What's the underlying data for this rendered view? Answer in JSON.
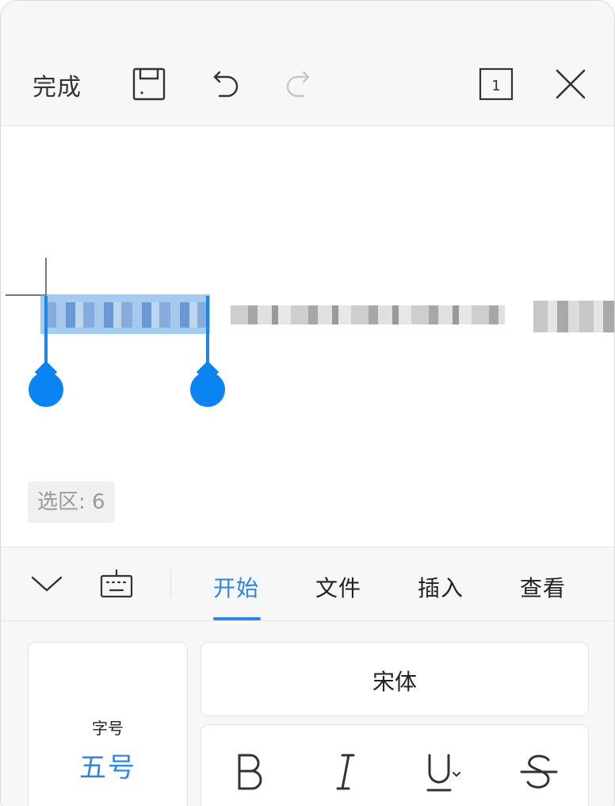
{
  "toolbar": {
    "done_label": "完成",
    "page_number": "1",
    "icons": [
      "save-icon",
      "undo-icon",
      "redo-icon",
      "page-count-icon",
      "close-icon"
    ]
  },
  "document": {
    "selection_count_label": "选区: 6"
  },
  "tabs": {
    "items": [
      {
        "label": "开始",
        "active": true
      },
      {
        "label": "文件",
        "active": false
      },
      {
        "label": "插入",
        "active": false
      },
      {
        "label": "查看",
        "active": false
      }
    ],
    "icons": [
      "chevron-down-icon",
      "keyboard-icon"
    ]
  },
  "format": {
    "font_size_label": "字号",
    "font_size_value": "五号",
    "font_family_value": "宋体",
    "styles": [
      "bold",
      "italic",
      "underline",
      "strikethrough"
    ]
  },
  "colors": {
    "accent": "#2f87e5",
    "handle": "#0a84f0",
    "selection": "#5aa0e6"
  }
}
